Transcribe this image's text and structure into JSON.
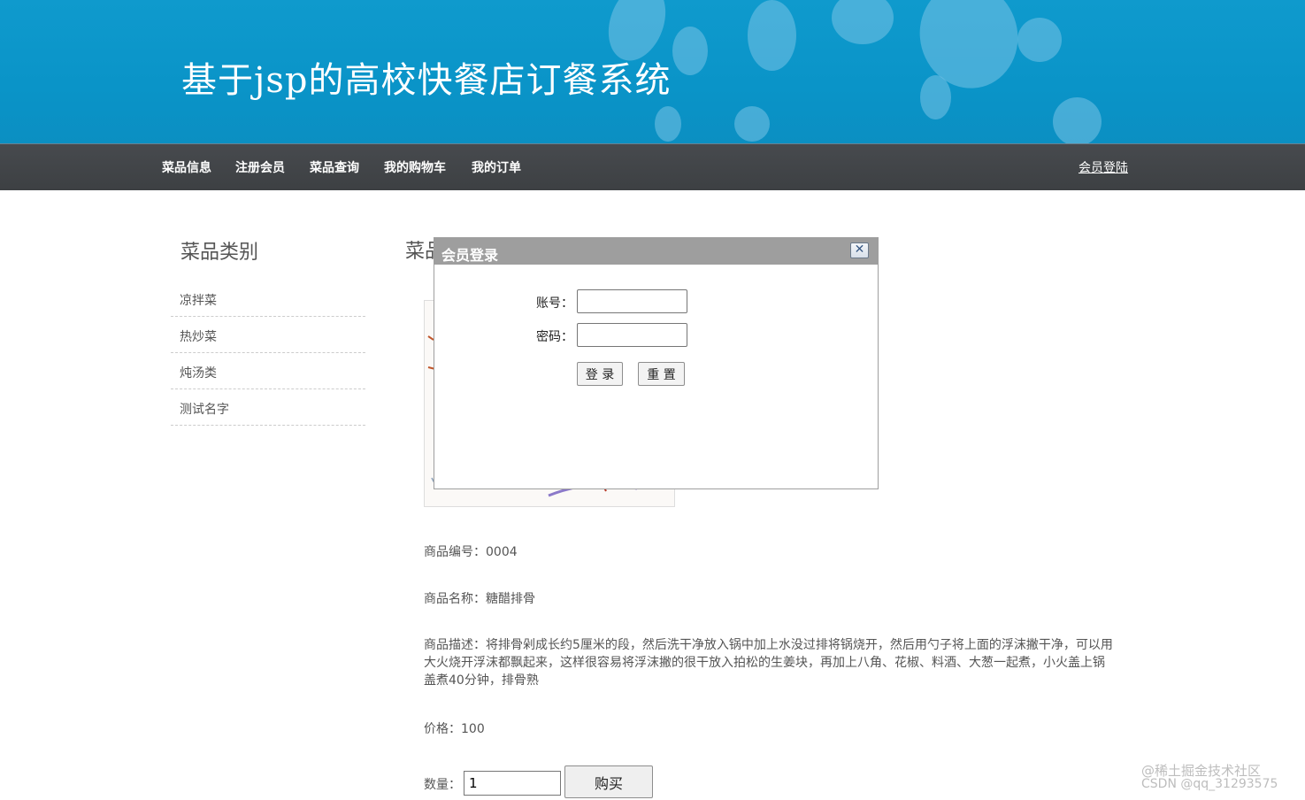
{
  "header": {
    "title": "基于jsp的高校快餐店订餐系统"
  },
  "nav": {
    "items": [
      {
        "label": "菜品信息"
      },
      {
        "label": "注册会员"
      },
      {
        "label": "菜品查询"
      },
      {
        "label": "我的购物车"
      },
      {
        "label": "我的订单"
      }
    ],
    "login": "会员登陆"
  },
  "sidebar": {
    "title": "菜品类别",
    "items": [
      {
        "label": "凉拌菜"
      },
      {
        "label": "热炒菜"
      },
      {
        "label": "炖汤类"
      },
      {
        "label": "测试名字"
      }
    ]
  },
  "main": {
    "title_visible": "菜品",
    "product": {
      "id_label": "商品编号：0004",
      "name_label": "商品名称：糖醋排骨",
      "desc_label": "商品描述：将排骨剁成长约5厘米的段，然后洗干净放入锅中加上水没过排将锅烧开，然后用勺子将上面的浮沫撇干净，可以用大火烧开浮沫都飘起来，这样很容易将浮沫撇的很干放入拍松的生姜块，再加上八角、花椒、料酒、大葱一起煮，小火盖上锅盖煮40分钟，排骨熟",
      "price_label": "价格：100"
    },
    "quantity_label": "数量：",
    "quantity_value": "1",
    "buy_button": "购买"
  },
  "dialog": {
    "title": "会员登录",
    "close_glyph": "✕",
    "account_label": "账号：",
    "password_label": "密码：",
    "login_button": "登 录",
    "reset_button": "重 置"
  },
  "watermark": {
    "line1": "@稀土掘金技术社区",
    "line2": "CSDN @qq_31293575"
  }
}
